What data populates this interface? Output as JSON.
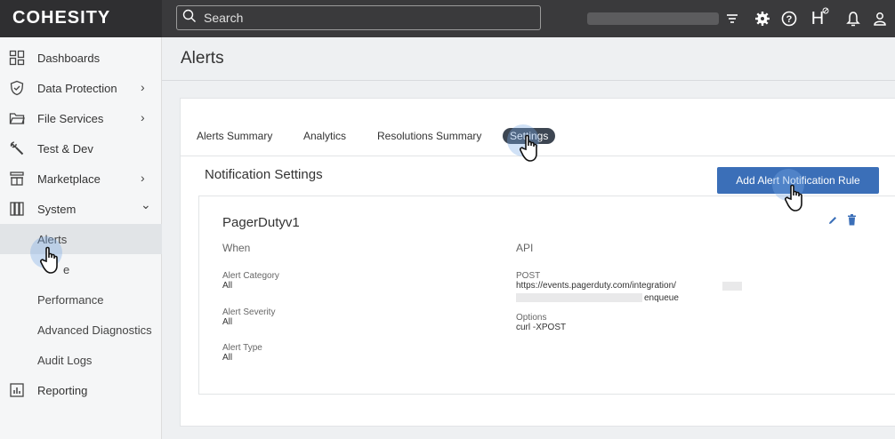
{
  "topbar": {
    "logo": "COHESITY",
    "search_placeholder": "Search",
    "icons": [
      "search-icon",
      "filter-icon",
      "gear-icon",
      "help-icon",
      "health-icon",
      "bell-icon",
      "user-icon"
    ],
    "health_glyph": "H"
  },
  "sidebar": {
    "items": [
      {
        "label": "Dashboards",
        "icon": "dashboard-icon"
      },
      {
        "label": "Data Protection",
        "icon": "shield-icon",
        "chevron": "›"
      },
      {
        "label": "File Services",
        "icon": "folder-icon",
        "chevron": "›"
      },
      {
        "label": "Test & Dev",
        "icon": "wrench-icon"
      },
      {
        "label": "Marketplace",
        "icon": "store-icon",
        "chevron": "›"
      },
      {
        "label": "System",
        "icon": "system-icon",
        "chevron": "⌄"
      }
    ],
    "system_sub": [
      {
        "label": "Alerts"
      },
      {
        "label": "e"
      },
      {
        "label": "Performance"
      },
      {
        "label": "Advanced Diagnostics"
      },
      {
        "label": "Audit Logs"
      }
    ],
    "reporting": {
      "label": "Reporting",
      "icon": "chart-icon"
    }
  },
  "main": {
    "title": "Alerts",
    "tabs": [
      {
        "label": "Alerts Summary"
      },
      {
        "label": "Analytics"
      },
      {
        "label": "Resolutions Summary"
      },
      {
        "label": "Settings"
      }
    ],
    "section_title": "Notification Settings",
    "add_button": "Add Alert Notification Rule",
    "rule": {
      "name": "PagerDutyv1",
      "when_header": "When",
      "api_header": "API",
      "alert_category_label": "Alert Category",
      "alert_category_value": "All",
      "alert_severity_label": "Alert Severity",
      "alert_severity_value": "All",
      "alert_type_label": "Alert Type",
      "alert_type_value": "All",
      "post_label": "POST",
      "post_url": "https://events.pagerduty.com/integration/",
      "post_url_tail": "enqueue",
      "options_label": "Options",
      "options_value": "curl -XPOST"
    }
  },
  "colors": {
    "topbar": "#3a3a3c",
    "accent": "#3b6fb8",
    "active_tab": "#3d4652"
  }
}
